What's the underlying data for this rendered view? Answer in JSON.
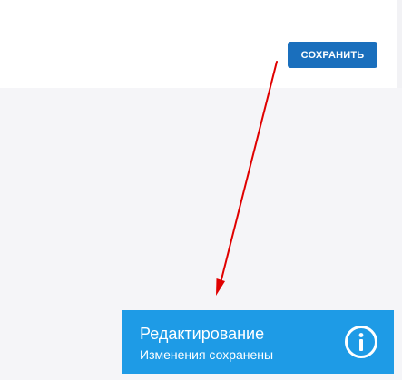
{
  "toolbar": {
    "save_label": "СОХРАНИТЬ"
  },
  "notification": {
    "title": "Редактирование",
    "message": "Изменения сохранены",
    "icon": "info-icon"
  },
  "colors": {
    "save_button": "#1a6fbd",
    "notification_background": "#1e9be6",
    "annotation_arrow": "#e00000",
    "page_background": "#f5f5f8"
  }
}
